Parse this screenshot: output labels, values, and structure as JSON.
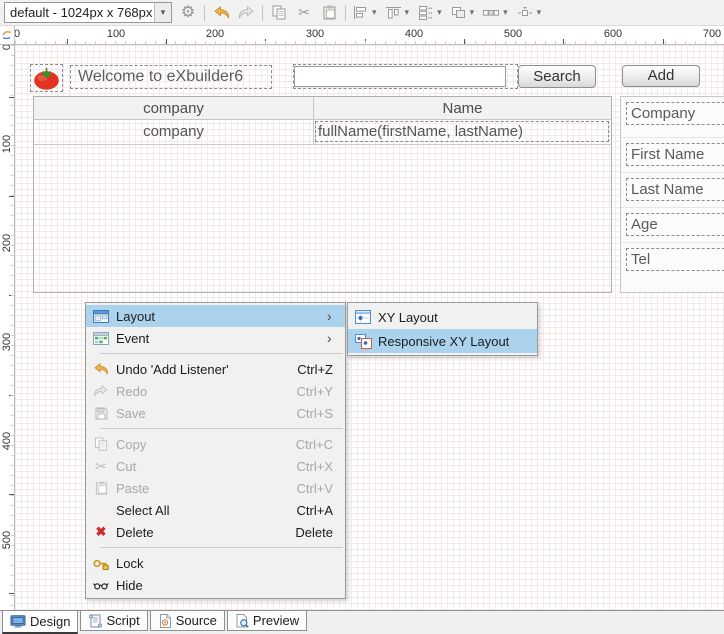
{
  "toolbar": {
    "preset_value": "default - 1024px x 768px",
    "buttons": [
      "settings-gear",
      "undo",
      "redo",
      "copy",
      "cut",
      "paste",
      "align-horizontal",
      "align-vertical",
      "distribute",
      "group",
      "match-size",
      "spacing"
    ]
  },
  "icon_glyphs": {
    "gear": "⚙",
    "cut": "✂",
    "delete": "✖",
    "dropdown_arrow": "▾",
    "submenu_arrow": "›"
  },
  "colors": {
    "menu_highlight": "#abd3ee",
    "undo_orange": "#f2b14e",
    "delete_red": "#cc2b2b",
    "tomato_red": "#e23222",
    "key_gold": "#cf9a22"
  },
  "rulers": {
    "horizontal": [
      "0",
      "100",
      "200",
      "300",
      "400",
      "500",
      "600",
      "700"
    ],
    "vertical": [
      "0",
      "100",
      "200",
      "300",
      "400",
      "500"
    ]
  },
  "canvas": {
    "welcome_text": "Welcome to eXbuilder6",
    "search_input": {
      "value": "",
      "placeholder": ""
    },
    "search_button_label": "Search",
    "add_button_label": "Add",
    "grid": {
      "columns": [
        "company",
        "Name"
      ],
      "rows": [
        [
          "company",
          "fullName(firstName, lastName)"
        ]
      ]
    },
    "form_labels": [
      "Company",
      "First Name",
      "Last Name",
      "Age",
      "Tel"
    ]
  },
  "context_menu": {
    "items": [
      {
        "label": "Layout",
        "shortcut": "",
        "icon": "layout-icon",
        "has_submenu": true,
        "highlighted": true
      },
      {
        "label": "Event",
        "shortcut": "",
        "icon": "event-icon",
        "has_submenu": true
      },
      {
        "label": "Undo 'Add Listener'",
        "shortcut": "Ctrl+Z",
        "icon": "undo-icon",
        "enabled": true
      },
      {
        "label": "Redo",
        "shortcut": "Ctrl+Y",
        "icon": "redo-icon",
        "enabled": false
      },
      {
        "label": "Save",
        "shortcut": "Ctrl+S",
        "icon": "save-icon",
        "enabled": false
      },
      {
        "label": "Copy",
        "shortcut": "Ctrl+C",
        "icon": "copy-icon",
        "enabled": false
      },
      {
        "label": "Cut",
        "shortcut": "Ctrl+X",
        "icon": "cut-icon",
        "enabled": false
      },
      {
        "label": "Paste",
        "shortcut": "Ctrl+V",
        "icon": "paste-icon",
        "enabled": false
      },
      {
        "label": "Select All",
        "shortcut": "Ctrl+A",
        "icon": "",
        "enabled": true
      },
      {
        "label": "Delete",
        "shortcut": "Delete",
        "icon": "delete-icon",
        "enabled": true
      },
      {
        "label": "Lock",
        "shortcut": "",
        "icon": "lock-icon",
        "enabled": true
      },
      {
        "label": "Hide",
        "shortcut": "",
        "icon": "hide-icon",
        "enabled": true
      }
    ]
  },
  "submenu": {
    "items": [
      {
        "label": "XY Layout",
        "icon": "xy-layout-icon",
        "highlighted": false
      },
      {
        "label": "Responsive XY Layout",
        "icon": "responsive-xy-layout-icon",
        "highlighted": true
      }
    ]
  },
  "bottom_tabs": [
    {
      "label": "Design",
      "icon": "design-icon",
      "active": true
    },
    {
      "label": "Script",
      "icon": "script-icon",
      "active": false
    },
    {
      "label": "Source",
      "icon": "source-icon",
      "active": false
    },
    {
      "label": "Preview",
      "icon": "preview-icon",
      "active": false
    }
  ]
}
